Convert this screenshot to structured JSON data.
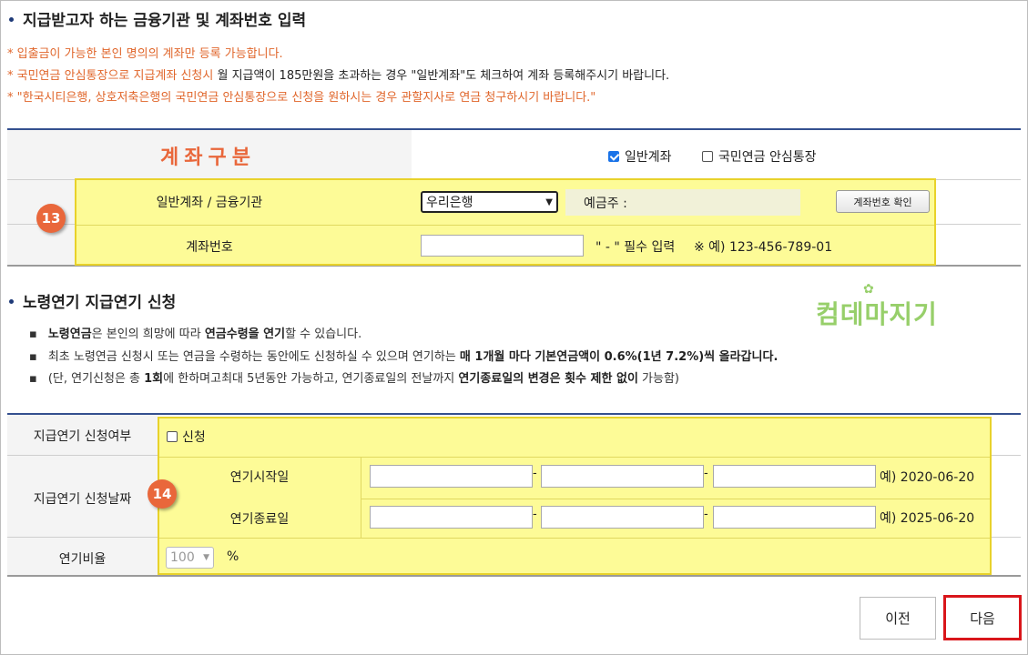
{
  "account_section": {
    "title": "지급받고자 하는 금융기관 및 계좌번호 입력",
    "notices": [
      {
        "prefix": "* 입출금이 가능한 본인 명의의 계좌만 등록 가능합니다.",
        "suffix": ""
      },
      {
        "prefix": "* 국민연금 안심통장으로 지급계좌 신청시 ",
        "suffix": "월 지급액이 185만원을 초과하는 경우 \"일반계좌\"도 체크하여 계좌 등록해주시기 바랍니다."
      },
      {
        "prefix": "* \"한국시티은행, 상호저축은행의 국민연금 안심통장으로 신청을 원하시는 경우 관할지사로 연금 청구하시기 바랍니다.\"",
        "suffix": ""
      }
    ],
    "type_label": "계좌구분",
    "options": [
      {
        "label": "일반계좌",
        "checked": true
      },
      {
        "label": "국민연금 안심통장",
        "checked": false
      }
    ],
    "bank_label": "일반계좌 / 금융기관",
    "bank_selected": "우리은행",
    "holder_label": "예금주 :",
    "verify_button": "계좌번호 확인",
    "account_label": "계좌번호",
    "account_value": "",
    "account_hint_required": "\" - \" 필수 입력",
    "account_hint_example": "※ 예) 123-456-789-01",
    "badge": "13"
  },
  "deferral_section": {
    "title": "노령연기 지급연기 신청",
    "info": [
      {
        "parts": [
          {
            "t": "노령연금",
            "b": true
          },
          {
            "t": "은 본인의 희망에 따라 ",
            "b": false
          },
          {
            "t": "연금수령을 연기",
            "b": true
          },
          {
            "t": "할 수 있습니다.",
            "b": false
          }
        ]
      },
      {
        "parts": [
          {
            "t": "최초 노령연금 신청시 또는 연금을 수령하는 동안에도 신청하실 수 있으며 연기하는 ",
            "b": false
          },
          {
            "t": "매 1개월 마다 기본연금액이 0.6%(1년 7.2%)씩 올라갑니다.",
            "b": true
          }
        ]
      },
      {
        "parts": [
          {
            "t": "(단, 연기신청은 총 ",
            "b": false
          },
          {
            "t": "1회",
            "b": true
          },
          {
            "t": "에 한하며고최대 5년동안 가능하고, 연기종료일의 전날까지 ",
            "b": false
          },
          {
            "t": "연기종료일의 변경은 횟수 제한 없이",
            "b": true
          },
          {
            "t": " 가능함)",
            "b": false
          }
        ]
      }
    ],
    "apply_label": "지급연기 신청여부",
    "apply_option": "신청",
    "date_label": "지급연기 신청날짜",
    "start_label": "연기시작일",
    "start_example": "예) 2020-06-20",
    "end_label": "연기종료일",
    "end_example": "예) 2025-06-20",
    "rate_label": "연기비율",
    "rate_value": "100",
    "rate_unit": "%",
    "badge": "14"
  },
  "watermark": "컴데마지기",
  "buttons": {
    "prev": "이전",
    "next": "다음"
  },
  "colors": {
    "accent": "#e9673b",
    "navy": "#34508f",
    "highlight": "#fdfb97",
    "next_border": "#d9161b"
  }
}
